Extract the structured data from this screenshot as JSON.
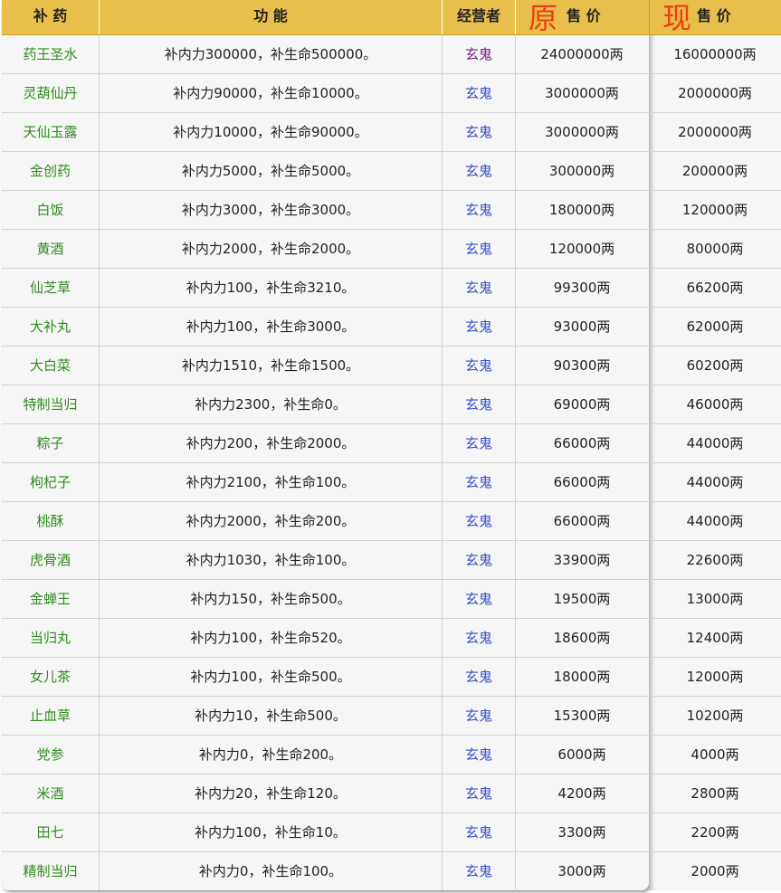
{
  "header": {
    "col_name": "补 药",
    "col_func": "功 能",
    "col_operator": "经营者",
    "col_orig_big": "原",
    "col_orig_label": "售 价",
    "col_now_big": "现",
    "col_now_label": "售 价"
  },
  "colors": {
    "header_bg": "#e8bf4a",
    "accent_red": "#ee3b12",
    "name_green": "#2f8b1e",
    "operator_blue": "#3a4ec2"
  },
  "rows": [
    {
      "name": "药王圣水",
      "func": "补内力300000，补生命500000。",
      "operator": "玄鬼",
      "orig": "24000000两",
      "now": "16000000两"
    },
    {
      "name": "灵葫仙丹",
      "func": "补内力90000，补生命10000。",
      "operator": "玄鬼",
      "orig": "3000000两",
      "now": "2000000两"
    },
    {
      "name": "天仙玉露",
      "func": "补内力10000，补生命90000。",
      "operator": "玄鬼",
      "orig": "3000000两",
      "now": "2000000两"
    },
    {
      "name": "金创药",
      "func": "补内力5000，补生命5000。",
      "operator": "玄鬼",
      "orig": "300000两",
      "now": "200000两"
    },
    {
      "name": "白饭",
      "func": "补内力3000，补生命3000。",
      "operator": "玄鬼",
      "orig": "180000两",
      "now": "120000两"
    },
    {
      "name": "黄酒",
      "func": "补内力2000，补生命2000。",
      "operator": "玄鬼",
      "orig": "120000两",
      "now": "80000两"
    },
    {
      "name": "仙芝草",
      "func": "补内力100，补生命3210。",
      "operator": "玄鬼",
      "orig": "99300两",
      "now": "66200两"
    },
    {
      "name": "大补丸",
      "func": "补内力100，补生命3000。",
      "operator": "玄鬼",
      "orig": "93000两",
      "now": "62000两"
    },
    {
      "name": "大白菜",
      "func": "补内力1510，补生命1500。",
      "operator": "玄鬼",
      "orig": "90300两",
      "now": "60200两"
    },
    {
      "name": "特制当归",
      "func": "补内力2300，补生命0。",
      "operator": "玄鬼",
      "orig": "69000两",
      "now": "46000两"
    },
    {
      "name": "粽子",
      "func": "补内力200，补生命2000。",
      "operator": "玄鬼",
      "orig": "66000两",
      "now": "44000两"
    },
    {
      "name": "枸杞子",
      "func": "补内力2100，补生命100。",
      "operator": "玄鬼",
      "orig": "66000两",
      "now": "44000两"
    },
    {
      "name": "桃酥",
      "func": "补内力2000，补生命200。",
      "operator": "玄鬼",
      "orig": "66000两",
      "now": "44000两"
    },
    {
      "name": "虎骨酒",
      "func": "补内力1030，补生命100。",
      "operator": "玄鬼",
      "orig": "33900两",
      "now": "22600两"
    },
    {
      "name": "金蝉王",
      "func": "补内力150，补生命500。",
      "operator": "玄鬼",
      "orig": "19500两",
      "now": "13000两"
    },
    {
      "name": "当归丸",
      "func": "补内力100，补生命520。",
      "operator": "玄鬼",
      "orig": "18600两",
      "now": "12400两"
    },
    {
      "name": "女儿茶",
      "func": "补内力100，补生命500。",
      "operator": "玄鬼",
      "orig": "18000两",
      "now": "12000两"
    },
    {
      "name": "止血草",
      "func": "补内力10，补生命500。",
      "operator": "玄鬼",
      "orig": "15300两",
      "now": "10200两"
    },
    {
      "name": "党参",
      "func": "补内力0，补生命200。",
      "operator": "玄鬼",
      "orig": "6000两",
      "now": "4000两"
    },
    {
      "name": "米酒",
      "func": "补内力20，补生命120。",
      "operator": "玄鬼",
      "orig": "4200两",
      "now": "2800两"
    },
    {
      "name": "田七",
      "func": "补内力100，补生命10。",
      "operator": "玄鬼",
      "orig": "3300两",
      "now": "2200两"
    },
    {
      "name": "精制当归",
      "func": "补内力0，补生命100。",
      "operator": "玄鬼",
      "orig": "3000两",
      "now": "2000两"
    }
  ]
}
